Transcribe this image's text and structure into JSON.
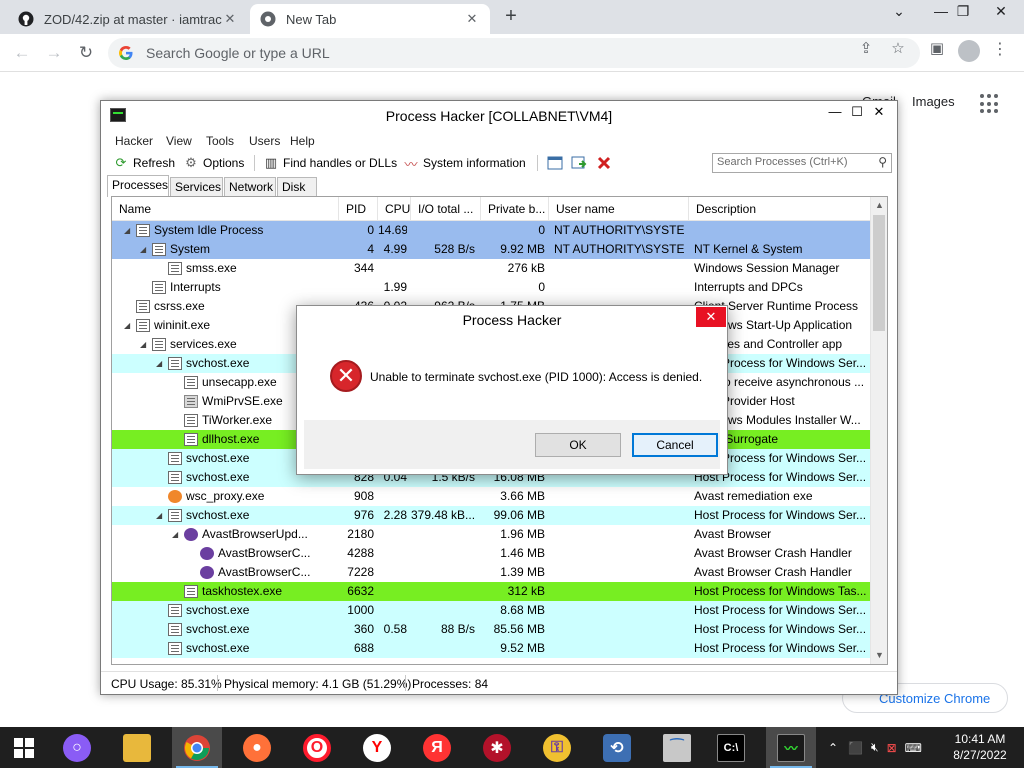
{
  "chrome": {
    "tabs": [
      {
        "title": "ZOD/42.zip at master · iamtraction",
        "close": "✕"
      },
      {
        "title": "New Tab",
        "close": "✕"
      }
    ],
    "new_tab": "+",
    "omnibox_placeholder": "Search Google or type a URL",
    "gmail_link": "Gmail",
    "images_link": "Images",
    "customize_label": "Customize Chrome"
  },
  "process_hacker": {
    "title": "Process Hacker [COLLABNET\\VM4]",
    "menu": [
      "Hacker",
      "View",
      "Tools",
      "Users",
      "Help"
    ],
    "toolbar": {
      "refresh": "Refresh",
      "options": "Options",
      "find_handles": "Find handles or DLLs",
      "system_info": "System information"
    },
    "search_placeholder": "Search Processes (Ctrl+K)",
    "tabs": [
      "Processes",
      "Services",
      "Network",
      "Disk"
    ],
    "columns": [
      "Name",
      "PID",
      "CPU",
      "I/O total ...",
      "Private b...",
      "User name",
      "Description"
    ],
    "rows": [
      {
        "name": "System Idle Process",
        "pid": "0",
        "cpu": "14.69",
        "io": "",
        "priv": "0",
        "user": "NT AUTHORITY\\SYSTEM",
        "desc": "",
        "color": "#99bbee",
        "indent": 0,
        "arrow": "◢",
        "icon": "window"
      },
      {
        "name": "System",
        "pid": "4",
        "cpu": "4.99",
        "io": "528 B/s",
        "priv": "9.92 MB",
        "user": "NT AUTHORITY\\SYSTEM",
        "desc": "NT Kernel & System",
        "color": "#99bbee",
        "indent": 1,
        "arrow": "◢",
        "icon": "window"
      },
      {
        "name": "smss.exe",
        "pid": "344",
        "cpu": "",
        "io": "",
        "priv": "276 kB",
        "user": "",
        "desc": "Windows Session Manager",
        "color": "#ffffff",
        "indent": 2,
        "arrow": "",
        "icon": "window"
      },
      {
        "name": "Interrupts",
        "pid": "",
        "cpu": "1.99",
        "io": "",
        "priv": "0",
        "user": "",
        "desc": "Interrupts and DPCs",
        "color": "#ffffff",
        "indent": 1,
        "arrow": "",
        "icon": "window"
      },
      {
        "name": "csrss.exe",
        "pid": "436",
        "cpu": "0.02",
        "io": "962 B/s",
        "priv": "1.75 MB",
        "user": "",
        "desc": "Client Server Runtime Process",
        "color": "#ffffff",
        "indent": 0,
        "arrow": "",
        "icon": "window"
      },
      {
        "name": "wininit.exe",
        "pid": "",
        "cpu": "",
        "io": "",
        "priv": "",
        "user": "",
        "desc": "Windows Start-Up Application",
        "color": "#ffffff",
        "indent": 0,
        "arrow": "◢",
        "icon": "window"
      },
      {
        "name": "services.exe",
        "pid": "",
        "cpu": "",
        "io": "",
        "priv": "",
        "user": "",
        "desc": "Services and Controller app",
        "color": "#ffffff",
        "indent": 1,
        "arrow": "◢",
        "icon": "window"
      },
      {
        "name": "svchost.exe",
        "pid": "",
        "cpu": "",
        "io": "",
        "priv": "",
        "user": "",
        "desc": "Host Process for Windows Ser...",
        "color": "#ccffff",
        "indent": 2,
        "arrow": "◢",
        "icon": "window"
      },
      {
        "name": "unsecapp.exe",
        "pid": "",
        "cpu": "",
        "io": "",
        "priv": "",
        "user": "",
        "desc": "Sink to receive asynchronous ...",
        "color": "#ffffff",
        "indent": 3,
        "arrow": "",
        "icon": "window"
      },
      {
        "name": "WmiPrvSE.exe",
        "pid": "",
        "cpu": "",
        "io": "",
        "priv": "",
        "user": "",
        "desc": "WMI Provider Host",
        "color": "#ffffff",
        "indent": 3,
        "arrow": "",
        "icon": "wmi"
      },
      {
        "name": "TiWorker.exe",
        "pid": "",
        "cpu": "",
        "io": "",
        "priv": "",
        "user": "",
        "desc": "Windows Modules Installer W...",
        "color": "#ffffff",
        "indent": 3,
        "arrow": "",
        "icon": "window"
      },
      {
        "name": "dllhost.exe",
        "pid": "",
        "cpu": "",
        "io": "",
        "priv": "",
        "user": "",
        "desc": "COM Surrogate",
        "color": "#77ee22",
        "indent": 3,
        "arrow": "",
        "icon": "window"
      },
      {
        "name": "svchost.exe",
        "pid": "",
        "cpu": "",
        "io": "",
        "priv": "",
        "user": "",
        "desc": "Host Process for Windows Ser...",
        "color": "#ccffff",
        "indent": 2,
        "arrow": "",
        "icon": "window"
      },
      {
        "name": "svchost.exe",
        "pid": "828",
        "cpu": "0.04",
        "io": "1.5 kB/s",
        "priv": "16.08 MB",
        "user": "",
        "desc": "Host Process for Windows Ser...",
        "color": "#ccffff",
        "indent": 2,
        "arrow": "",
        "icon": "window"
      },
      {
        "name": "wsc_proxy.exe",
        "pid": "908",
        "cpu": "",
        "io": "",
        "priv": "3.66 MB",
        "user": "",
        "desc": "Avast remediation exe",
        "color": "#ffffff",
        "indent": 2,
        "arrow": "",
        "icon": "avast"
      },
      {
        "name": "svchost.exe",
        "pid": "976",
        "cpu": "2.28",
        "io": "379.48 kB...",
        "priv": "99.06 MB",
        "user": "",
        "desc": "Host Process for Windows Ser...",
        "color": "#ccffff",
        "indent": 2,
        "arrow": "◢",
        "icon": "window"
      },
      {
        "name": "AvastBrowserUpd...",
        "pid": "2180",
        "cpu": "",
        "io": "",
        "priv": "1.96 MB",
        "user": "",
        "desc": "Avast Browser",
        "color": "#ffffff",
        "indent": 3,
        "arrow": "◢",
        "icon": "browser"
      },
      {
        "name": "AvastBrowserC...",
        "pid": "4288",
        "cpu": "",
        "io": "",
        "priv": "1.46 MB",
        "user": "",
        "desc": "Avast Browser Crash Handler",
        "color": "#ffffff",
        "indent": 4,
        "arrow": "",
        "icon": "browser"
      },
      {
        "name": "AvastBrowserC...",
        "pid": "7228",
        "cpu": "",
        "io": "",
        "priv": "1.39 MB",
        "user": "",
        "desc": "Avast Browser Crash Handler",
        "color": "#ffffff",
        "indent": 4,
        "arrow": "",
        "icon": "browser"
      },
      {
        "name": "taskhostex.exe",
        "pid": "6632",
        "cpu": "",
        "io": "",
        "priv": "312 kB",
        "user": "",
        "desc": "Host Process for Windows Tas...",
        "color": "#77ee22",
        "indent": 3,
        "arrow": "",
        "icon": "window"
      },
      {
        "name": "svchost.exe",
        "pid": "1000",
        "cpu": "",
        "io": "",
        "priv": "8.68 MB",
        "user": "",
        "desc": "Host Process for Windows Ser...",
        "color": "#ccffff",
        "indent": 2,
        "arrow": "",
        "icon": "window"
      },
      {
        "name": "svchost.exe",
        "pid": "360",
        "cpu": "0.58",
        "io": "88 B/s",
        "priv": "85.56 MB",
        "user": "",
        "desc": "Host Process for Windows Ser...",
        "color": "#ccffff",
        "indent": 2,
        "arrow": "",
        "icon": "window"
      },
      {
        "name": "svchost.exe",
        "pid": "688",
        "cpu": "",
        "io": "",
        "priv": "9.52 MB",
        "user": "",
        "desc": "Host Process for Windows Ser...",
        "color": "#ccffff",
        "indent": 2,
        "arrow": "",
        "icon": "window"
      }
    ],
    "status": {
      "cpu": "CPU Usage: 85.31%",
      "memory": "Physical memory: 4.1 GB (51.29%)",
      "processes": "Processes: 84"
    }
  },
  "dialog": {
    "title": "Process Hacker",
    "close": "✕",
    "message": "Unable to terminate svchost.exe (PID 1000): Access is denied.",
    "ok": "OK",
    "cancel": "Cancel"
  },
  "taskbar": {
    "time": "10:41 AM",
    "date": "8/27/2022"
  }
}
